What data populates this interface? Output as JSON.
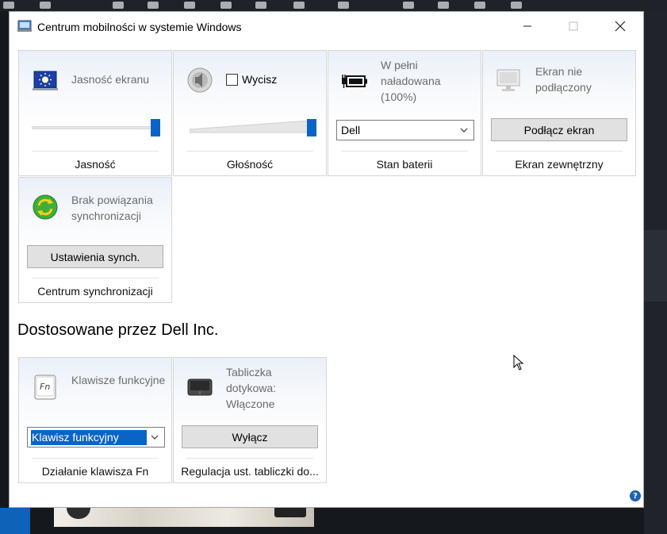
{
  "window": {
    "title": "Centrum mobilności w systemie Windows",
    "section_title": "Dostosowane przez Dell Inc."
  },
  "tiles": {
    "brightness": {
      "status": "Jasność ekranu",
      "label": "Jasność",
      "level_percent": 100
    },
    "volume": {
      "mute_label": "Wycisz",
      "muted": false,
      "label": "Głośność",
      "level_percent": 100
    },
    "battery": {
      "status": "W pełni naładowana (100%)",
      "plan": "Dell",
      "label": "Stan baterii"
    },
    "display": {
      "status": "Ekran nie podłączony",
      "button": "Podłącz ekran",
      "label": "Ekran zewnętrzny"
    },
    "sync": {
      "status": "Brak powiązania synchronizacji",
      "button": "Ustawienia synch.",
      "label": "Centrum synchronizacji"
    },
    "fnkey": {
      "status": "Klawisze funkcyjne",
      "value": "Klawisz funkcyjny",
      "label": "Działanie klawisza Fn",
      "icon_text": "Fn"
    },
    "touchpad": {
      "status": "Tabliczka dotykowa: Włączone",
      "button": "Wyłącz",
      "label": "Regulacja ust. tabliczki do..."
    }
  },
  "icons": {
    "app": "mobility-center-icon",
    "brightness": "brightness-icon",
    "volume": "speaker-icon",
    "battery": "battery-plug-icon",
    "display": "monitor-icon",
    "sync": "sync-icon",
    "fnkey": "fn-key-icon",
    "touchpad": "touchpad-icon",
    "help": "help-icon"
  },
  "help": {
    "glyph": "?"
  },
  "colors": {
    "accent": "#0a64c8",
    "help": "#1e5fb3"
  }
}
